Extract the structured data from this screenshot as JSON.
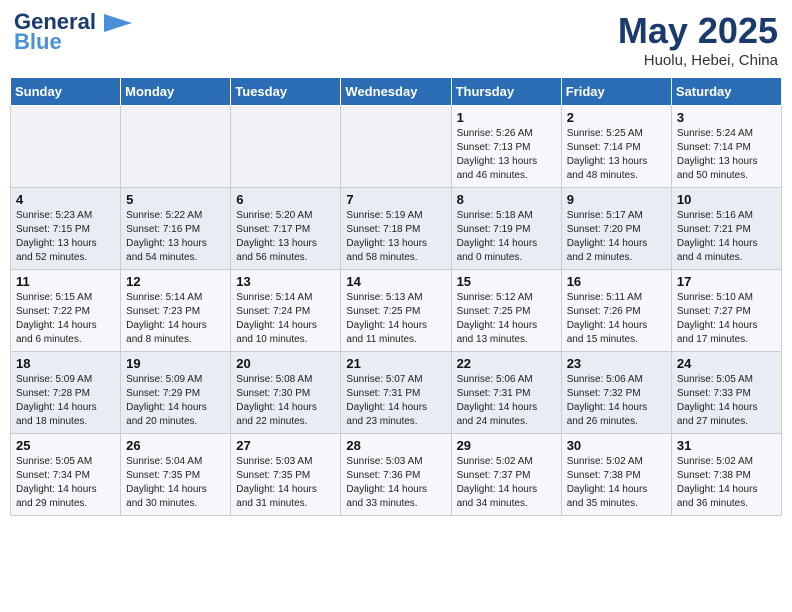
{
  "header": {
    "logo_line1": "General",
    "logo_line2": "Blue",
    "title": "May 2025",
    "location": "Huolu, Hebei, China"
  },
  "weekdays": [
    "Sunday",
    "Monday",
    "Tuesday",
    "Wednesday",
    "Thursday",
    "Friday",
    "Saturday"
  ],
  "weeks": [
    [
      {
        "day": "",
        "info": ""
      },
      {
        "day": "",
        "info": ""
      },
      {
        "day": "",
        "info": ""
      },
      {
        "day": "",
        "info": ""
      },
      {
        "day": "1",
        "info": "Sunrise: 5:26 AM\nSunset: 7:13 PM\nDaylight: 13 hours\nand 46 minutes."
      },
      {
        "day": "2",
        "info": "Sunrise: 5:25 AM\nSunset: 7:14 PM\nDaylight: 13 hours\nand 48 minutes."
      },
      {
        "day": "3",
        "info": "Sunrise: 5:24 AM\nSunset: 7:14 PM\nDaylight: 13 hours\nand 50 minutes."
      }
    ],
    [
      {
        "day": "4",
        "info": "Sunrise: 5:23 AM\nSunset: 7:15 PM\nDaylight: 13 hours\nand 52 minutes."
      },
      {
        "day": "5",
        "info": "Sunrise: 5:22 AM\nSunset: 7:16 PM\nDaylight: 13 hours\nand 54 minutes."
      },
      {
        "day": "6",
        "info": "Sunrise: 5:20 AM\nSunset: 7:17 PM\nDaylight: 13 hours\nand 56 minutes."
      },
      {
        "day": "7",
        "info": "Sunrise: 5:19 AM\nSunset: 7:18 PM\nDaylight: 13 hours\nand 58 minutes."
      },
      {
        "day": "8",
        "info": "Sunrise: 5:18 AM\nSunset: 7:19 PM\nDaylight: 14 hours\nand 0 minutes."
      },
      {
        "day": "9",
        "info": "Sunrise: 5:17 AM\nSunset: 7:20 PM\nDaylight: 14 hours\nand 2 minutes."
      },
      {
        "day": "10",
        "info": "Sunrise: 5:16 AM\nSunset: 7:21 PM\nDaylight: 14 hours\nand 4 minutes."
      }
    ],
    [
      {
        "day": "11",
        "info": "Sunrise: 5:15 AM\nSunset: 7:22 PM\nDaylight: 14 hours\nand 6 minutes."
      },
      {
        "day": "12",
        "info": "Sunrise: 5:14 AM\nSunset: 7:23 PM\nDaylight: 14 hours\nand 8 minutes."
      },
      {
        "day": "13",
        "info": "Sunrise: 5:14 AM\nSunset: 7:24 PM\nDaylight: 14 hours\nand 10 minutes."
      },
      {
        "day": "14",
        "info": "Sunrise: 5:13 AM\nSunset: 7:25 PM\nDaylight: 14 hours\nand 11 minutes."
      },
      {
        "day": "15",
        "info": "Sunrise: 5:12 AM\nSunset: 7:25 PM\nDaylight: 14 hours\nand 13 minutes."
      },
      {
        "day": "16",
        "info": "Sunrise: 5:11 AM\nSunset: 7:26 PM\nDaylight: 14 hours\nand 15 minutes."
      },
      {
        "day": "17",
        "info": "Sunrise: 5:10 AM\nSunset: 7:27 PM\nDaylight: 14 hours\nand 17 minutes."
      }
    ],
    [
      {
        "day": "18",
        "info": "Sunrise: 5:09 AM\nSunset: 7:28 PM\nDaylight: 14 hours\nand 18 minutes."
      },
      {
        "day": "19",
        "info": "Sunrise: 5:09 AM\nSunset: 7:29 PM\nDaylight: 14 hours\nand 20 minutes."
      },
      {
        "day": "20",
        "info": "Sunrise: 5:08 AM\nSunset: 7:30 PM\nDaylight: 14 hours\nand 22 minutes."
      },
      {
        "day": "21",
        "info": "Sunrise: 5:07 AM\nSunset: 7:31 PM\nDaylight: 14 hours\nand 23 minutes."
      },
      {
        "day": "22",
        "info": "Sunrise: 5:06 AM\nSunset: 7:31 PM\nDaylight: 14 hours\nand 24 minutes."
      },
      {
        "day": "23",
        "info": "Sunrise: 5:06 AM\nSunset: 7:32 PM\nDaylight: 14 hours\nand 26 minutes."
      },
      {
        "day": "24",
        "info": "Sunrise: 5:05 AM\nSunset: 7:33 PM\nDaylight: 14 hours\nand 27 minutes."
      }
    ],
    [
      {
        "day": "25",
        "info": "Sunrise: 5:05 AM\nSunset: 7:34 PM\nDaylight: 14 hours\nand 29 minutes."
      },
      {
        "day": "26",
        "info": "Sunrise: 5:04 AM\nSunset: 7:35 PM\nDaylight: 14 hours\nand 30 minutes."
      },
      {
        "day": "27",
        "info": "Sunrise: 5:03 AM\nSunset: 7:35 PM\nDaylight: 14 hours\nand 31 minutes."
      },
      {
        "day": "28",
        "info": "Sunrise: 5:03 AM\nSunset: 7:36 PM\nDaylight: 14 hours\nand 33 minutes."
      },
      {
        "day": "29",
        "info": "Sunrise: 5:02 AM\nSunset: 7:37 PM\nDaylight: 14 hours\nand 34 minutes."
      },
      {
        "day": "30",
        "info": "Sunrise: 5:02 AM\nSunset: 7:38 PM\nDaylight: 14 hours\nand 35 minutes."
      },
      {
        "day": "31",
        "info": "Sunrise: 5:02 AM\nSunset: 7:38 PM\nDaylight: 14 hours\nand 36 minutes."
      }
    ]
  ]
}
